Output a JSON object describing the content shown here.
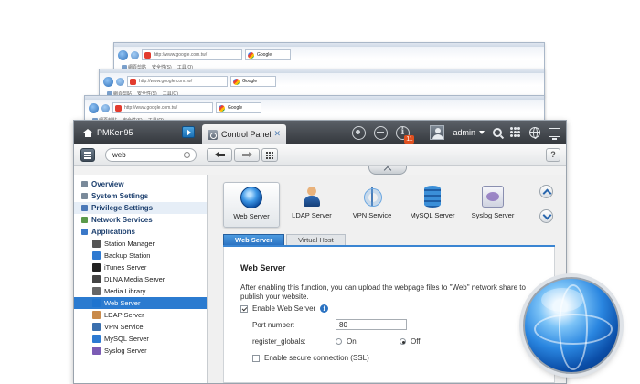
{
  "browsers": [
    {
      "url": "http://www.google.com.tw/",
      "tab": "Google",
      "menu": [
        "網頁剪貼",
        "安全性(S)",
        "工具(O)"
      ]
    },
    {
      "url": "http://www.google.com.tw/",
      "tab": "Google",
      "menu": [
        "網頁剪貼",
        "安全性(S)",
        "工具(O)"
      ]
    },
    {
      "url": "http://www.google.com.tw/",
      "tab": "Google",
      "menu": [
        "網頁剪貼",
        "安全性(S)",
        "工具(O)"
      ]
    }
  ],
  "taskbar": {
    "host": "PMKen95",
    "app_tab": "Control Panel",
    "notification_count": "11",
    "user": "admin"
  },
  "toolbar": {
    "search_value": "web",
    "help": "?"
  },
  "sidebar": {
    "sections": [
      {
        "label": "Overview",
        "color": "#7a8a9a"
      },
      {
        "label": "System Settings",
        "color": "#7a8a9a"
      },
      {
        "label": "Privilege Settings",
        "color": "#4a78b8"
      },
      {
        "label": "Network Services",
        "color": "#5a9a4a"
      },
      {
        "label": "Applications",
        "color": "#3a78c8"
      }
    ],
    "items": [
      {
        "label": "Station Manager",
        "icon": "#555"
      },
      {
        "label": "Backup Station",
        "icon": "#2e7ad1"
      },
      {
        "label": "iTunes Server",
        "icon": "#222"
      },
      {
        "label": "DLNA Media Server",
        "icon": "#444"
      },
      {
        "label": "Media Library",
        "icon": "#666"
      },
      {
        "label": "Web Server",
        "icon": "#1f74cf"
      },
      {
        "label": "LDAP Server",
        "icon": "#c98a4a"
      },
      {
        "label": "VPN Service",
        "icon": "#3a6fae"
      },
      {
        "label": "MySQL Server",
        "icon": "#2c7ad2"
      },
      {
        "label": "Syslog Server",
        "icon": "#7b5bb4"
      }
    ],
    "active_index": 5
  },
  "apps": [
    {
      "label": "Web Server"
    },
    {
      "label": "LDAP Server"
    },
    {
      "label": "VPN Service"
    },
    {
      "label": "MySQL Server"
    },
    {
      "label": "Syslog Server"
    }
  ],
  "tabs": [
    "Web Server",
    "Virtual Host"
  ],
  "web_server": {
    "title": "Web Server",
    "description": "After enabling this function, you can upload the webpage files to \"Web\" network share to publish your website.",
    "enable_label": "Enable Web Server",
    "port_label": "Port number:",
    "port_value": "80",
    "register_globals_label": "register_globals:",
    "on_label": "On",
    "off_label": "Off",
    "ssl_label": "Enable secure connection (SSL)"
  }
}
